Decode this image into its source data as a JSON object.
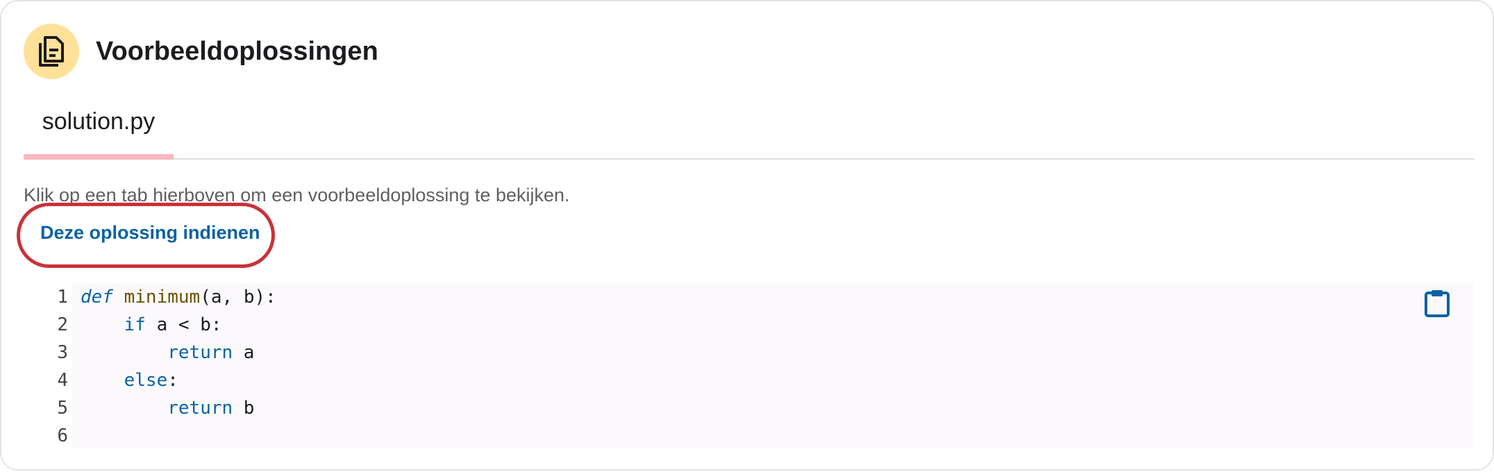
{
  "header": {
    "icon": "file-copy-icon",
    "title": "Voorbeeldoplossingen"
  },
  "tabs": [
    {
      "label": "solution.py",
      "selected": true
    }
  ],
  "hint_text": "Klik op een tab hierboven om een voorbeeldoplossing te bekijken.",
  "submit_link_label": "Deze oplossing indienen",
  "code": {
    "line_numbers": [
      "1",
      "2",
      "3",
      "4",
      "5",
      "6"
    ],
    "lines": [
      {
        "indent": "",
        "tokens": [
          [
            "def",
            "kw-def"
          ],
          [
            " ",
            ""
          ],
          [
            "minimum",
            "fn"
          ],
          [
            "(a, b):",
            ""
          ]
        ]
      },
      {
        "indent": "    ",
        "tokens": [
          [
            "if",
            "kw"
          ],
          [
            " a < b:",
            ""
          ]
        ]
      },
      {
        "indent": "        ",
        "tokens": [
          [
            "return",
            "kw"
          ],
          [
            " a",
            ""
          ]
        ]
      },
      {
        "indent": "    ",
        "tokens": [
          [
            "else",
            "kw"
          ],
          [
            ":",
            ""
          ]
        ]
      },
      {
        "indent": "        ",
        "tokens": [
          [
            "return",
            "kw"
          ],
          [
            " b",
            ""
          ]
        ]
      },
      {
        "indent": "",
        "tokens": []
      }
    ],
    "copy_icon": "clipboard-icon"
  },
  "colors": {
    "accent_blue": "#0b62a3",
    "tab_indicator": "#f8b8c0",
    "header_icon_bg": "#ffe199",
    "highlight_ring": "#c9333a"
  }
}
